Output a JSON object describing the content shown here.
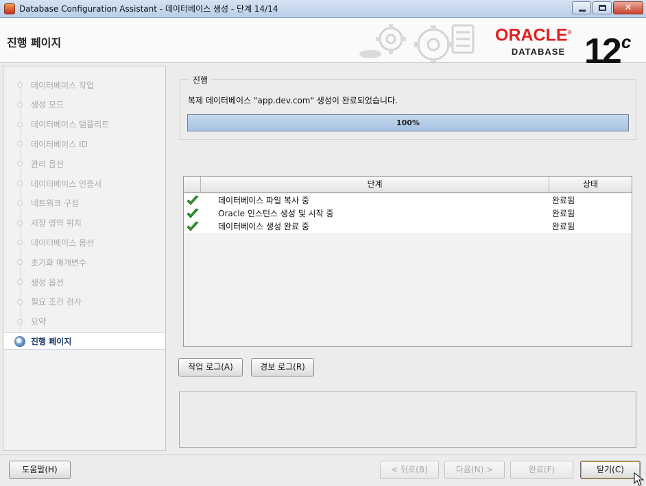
{
  "window": {
    "title": "Database Configuration Assistant - 데이터베이스 생성 - 단계 14/14",
    "controls": [
      "minimize",
      "maximize",
      "close"
    ]
  },
  "header": {
    "page_title": "진행 페이지",
    "logo_wordmark": "ORACLE",
    "logo_registered": "®",
    "logo_product": "DATABASE",
    "version_number": "12",
    "version_suffix": "c"
  },
  "steps": [
    {
      "label": "데이터베이스 작업",
      "active": false
    },
    {
      "label": "생성 모드",
      "active": false
    },
    {
      "label": "데이터베이스 템플리트",
      "active": false
    },
    {
      "label": "데이터베이스 ID",
      "active": false
    },
    {
      "label": "관리 옵션",
      "active": false
    },
    {
      "label": "데이터베이스 인증서",
      "active": false
    },
    {
      "label": "네트워크 구성",
      "active": false
    },
    {
      "label": "저장 영역 위치",
      "active": false
    },
    {
      "label": "데이터베이스 옵션",
      "active": false
    },
    {
      "label": "초기화 매개변수",
      "active": false
    },
    {
      "label": "생성 옵션",
      "active": false
    },
    {
      "label": "필요 조건 검사",
      "active": false
    },
    {
      "label": "요약",
      "active": false
    },
    {
      "label": "진행 페이지",
      "active": true
    }
  ],
  "progress": {
    "group_label": "진행",
    "message": "복제 데이터베이스 \"app.dev.com\" 생성이 완료되었습니다.",
    "percent": 100,
    "percent_label": "100%"
  },
  "table": {
    "headers": {
      "step": "단계",
      "status": "상태"
    },
    "rows": [
      {
        "step": "데이터베이스 파일 복사 중",
        "status": "완료됨",
        "icon": "check-icon"
      },
      {
        "step": "Oracle 인스턴스 생성 및 시작 중",
        "status": "완료됨",
        "icon": "check-icon"
      },
      {
        "step": "데이터베이스 생성 완료 중",
        "status": "완료됨",
        "icon": "check-icon"
      }
    ]
  },
  "buttons": {
    "activity_log": "작업 로그(A)",
    "alert_log": "경보 로그(R)",
    "help": "도움말(H)",
    "back": "< 뒤로(B)",
    "next": "다음(N) >",
    "finish": "완료(F)",
    "close": "닫기(C)"
  },
  "colors": {
    "oracle_red": "#e02020",
    "progress_fill": "#a7c2e2",
    "check_green": "#2f9a2f"
  }
}
